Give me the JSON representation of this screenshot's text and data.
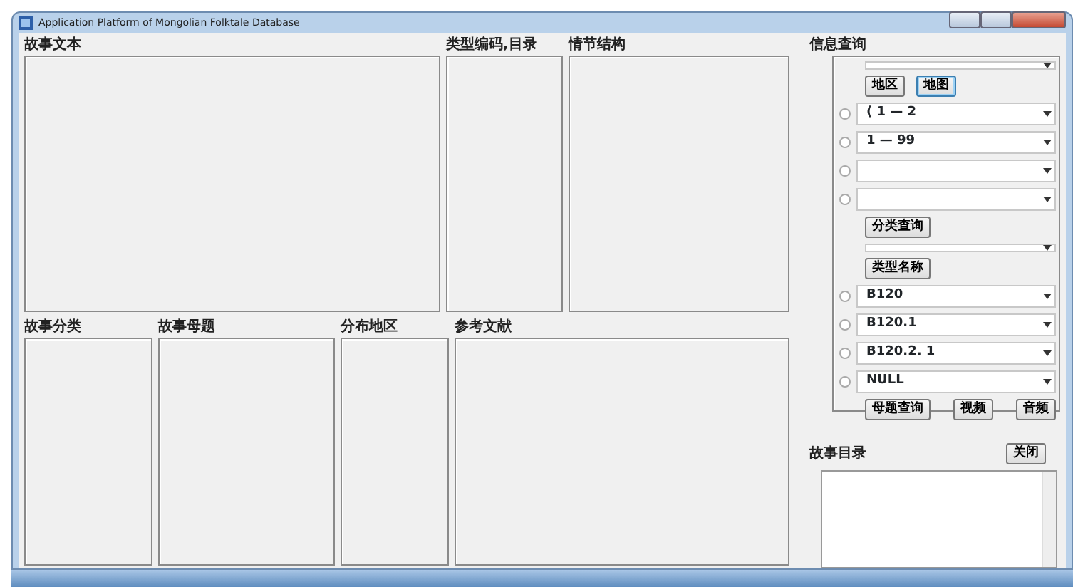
{
  "window": {
    "title": "Application Platform of Mongolian Folktale Database"
  },
  "top_panels": [
    {
      "label": "故事文本"
    },
    {
      "label": "类型编码,目录"
    },
    {
      "label": "情节结构"
    }
  ],
  "bottom_panels": [
    {
      "label": "故事分类"
    },
    {
      "label": "故事母题"
    },
    {
      "label": "分布地区"
    },
    {
      "label": "参考文献"
    }
  ],
  "query": {
    "heading": "信息查询",
    "region_buttons": [
      {
        "label": "地区",
        "focused": false
      },
      {
        "label": "地图",
        "focused": true
      }
    ],
    "rows_a": [
      {
        "selected": false,
        "value": "( 1 — 2"
      },
      {
        "selected": false,
        "value": "1 — 99"
      },
      {
        "selected": false
      },
      {
        "selected": false
      }
    ],
    "classify_button": "分类查询",
    "type_name_button": "类型名称",
    "rows_b": [
      {
        "selected": false,
        "value": "B120"
      },
      {
        "selected": false,
        "value": "B120.1"
      },
      {
        "selected": false,
        "value": "B120.2. 1"
      },
      {
        "selected": false,
        "value": "NULL"
      }
    ],
    "action_buttons": [
      "母题查询",
      "视频",
      "音频"
    ]
  },
  "catalog": {
    "heading": "故事目录",
    "close_button": "关闭"
  }
}
